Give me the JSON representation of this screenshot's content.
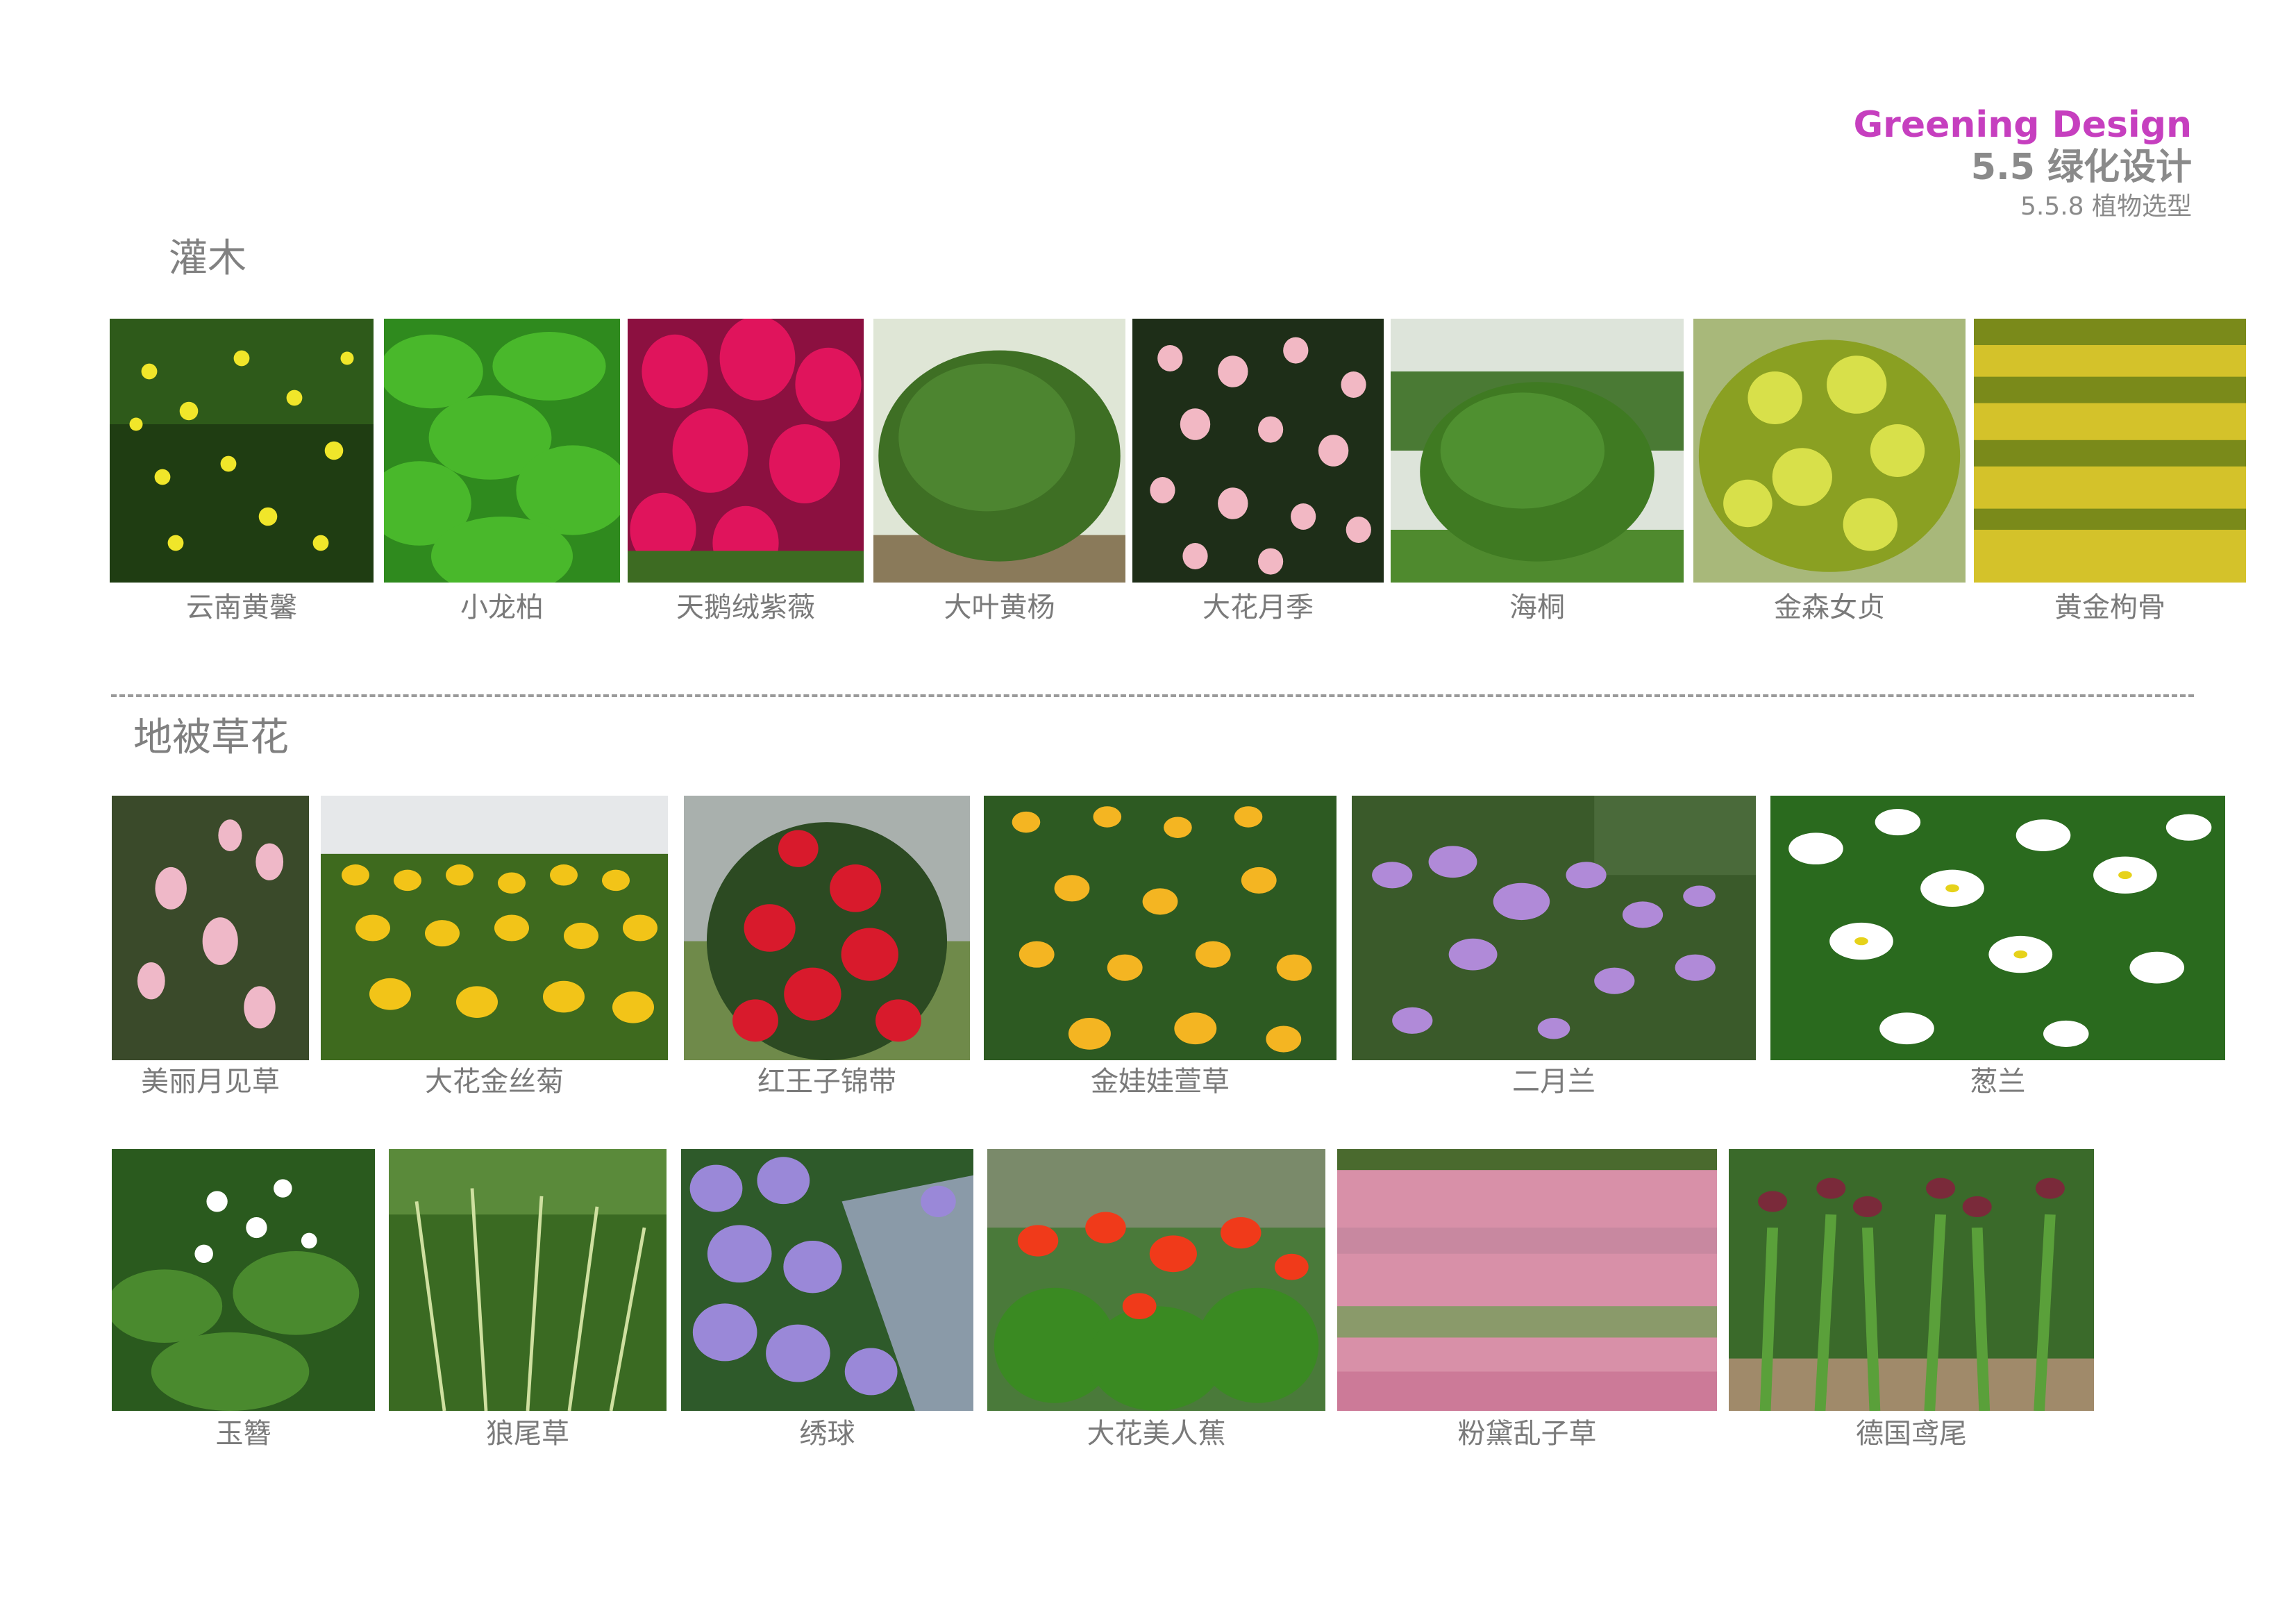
{
  "header": {
    "title_en": "Greening Design",
    "title_cn": "5.5  绿化设计",
    "subtitle": "5.5.8 植物选型"
  },
  "sections": {
    "shrubs": {
      "title": "灌木"
    },
    "groundcover": {
      "title": "地被草花"
    }
  },
  "plants": {
    "shrubs": [
      {
        "name": "云南黄馨",
        "icon": "yellow-jasmine-photo"
      },
      {
        "name": "小龙柏",
        "icon": "juniper-photo"
      },
      {
        "name": "天鹅绒紫薇",
        "icon": "crape-myrtle-photo"
      },
      {
        "name": "大叶黄杨",
        "icon": "boxwood-ball-photo"
      },
      {
        "name": "大花月季",
        "icon": "rose-shrub-photo"
      },
      {
        "name": "海桐",
        "icon": "pittosporum-ball-photo"
      },
      {
        "name": "金森女贞",
        "icon": "golden-privet-photo"
      },
      {
        "name": "黄金枸骨",
        "icon": "golden-holly-photo"
      }
    ],
    "ground_row1": [
      {
        "name": "美丽月见草",
        "icon": "evening-primrose-photo"
      },
      {
        "name": "大花金丝菊",
        "icon": "coreopsis-photo"
      },
      {
        "name": "红王子锦带",
        "icon": "weigela-photo"
      },
      {
        "name": "金娃娃萱草",
        "icon": "daylily-photo"
      },
      {
        "name": "二月兰",
        "icon": "orychophragmus-photo"
      },
      {
        "name": "葱兰",
        "icon": "zephyranthes-photo"
      }
    ],
    "ground_row2": [
      {
        "name": "玉簪",
        "icon": "hosta-photo"
      },
      {
        "name": "狼尾草",
        "icon": "fountain-grass-photo"
      },
      {
        "name": "绣球",
        "icon": "hydrangea-photo"
      },
      {
        "name": "大花美人蕉",
        "icon": "canna-photo"
      },
      {
        "name": "粉黛乱子草",
        "icon": "pink-muhly-photo"
      },
      {
        "name": "德国鸢尾",
        "icon": "bearded-iris-photo"
      }
    ]
  }
}
